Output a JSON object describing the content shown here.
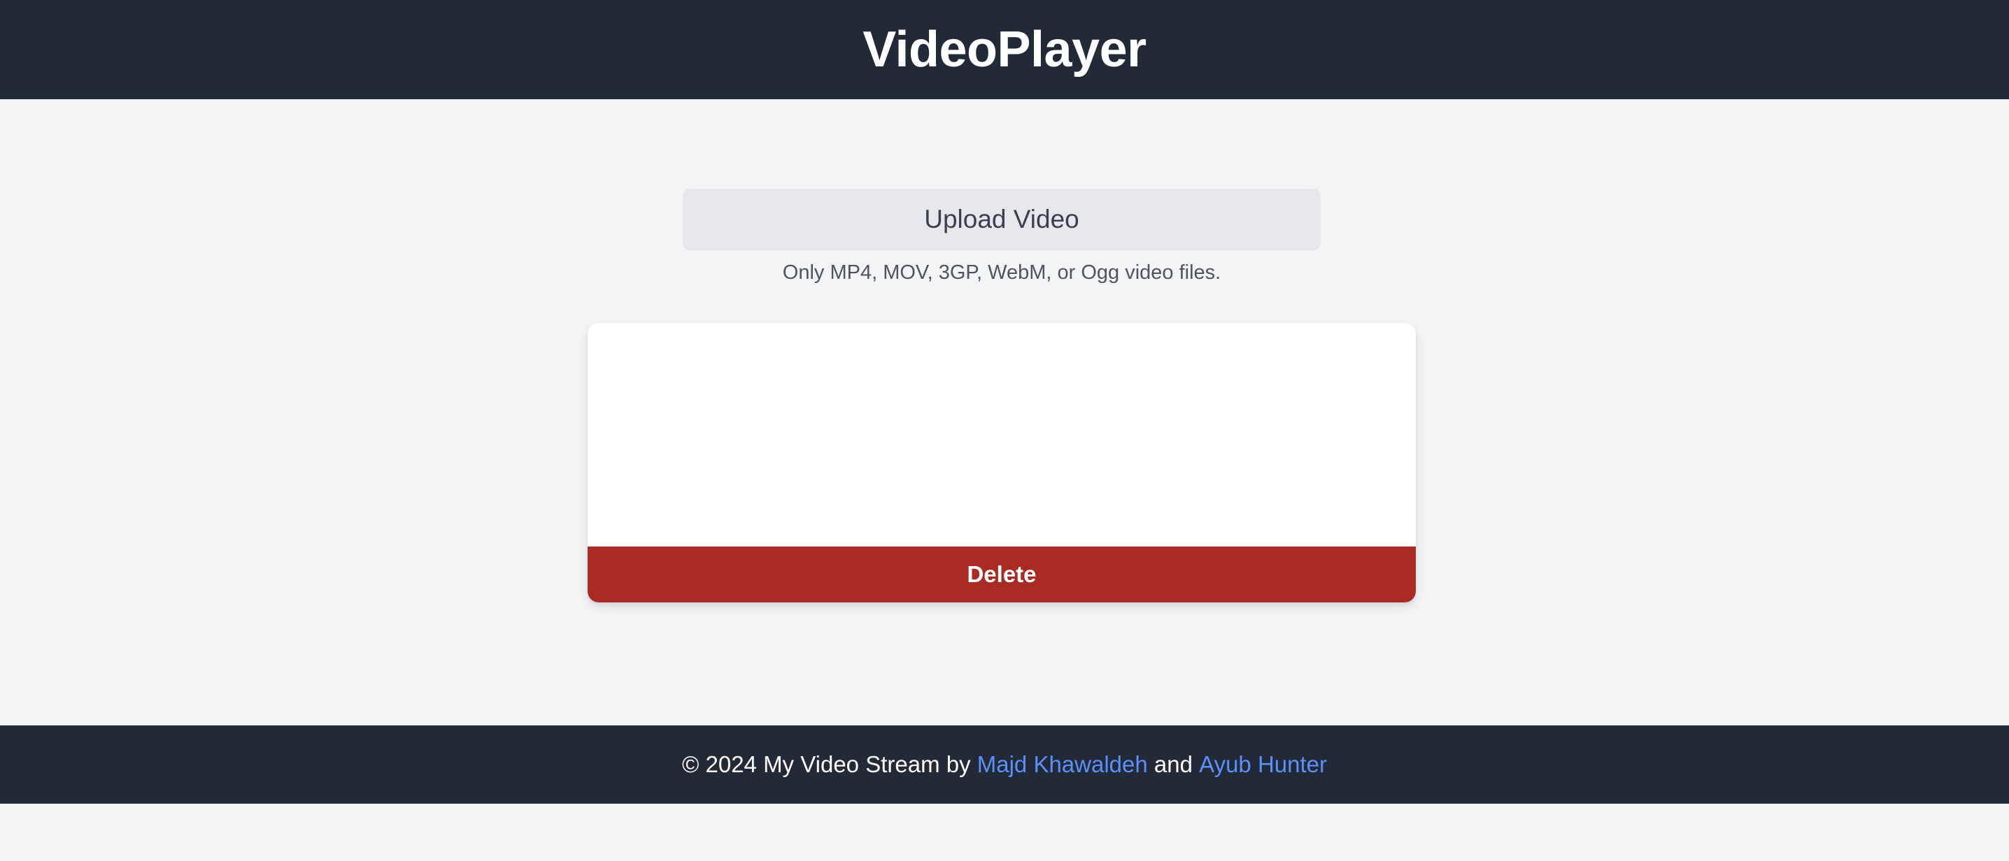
{
  "header": {
    "title": "VideoPlayer"
  },
  "upload": {
    "button_label": "Upload Video",
    "hint": "Only MP4, MOV, 3GP, WebM, or Ogg video files."
  },
  "video_card": {
    "delete_label": "Delete"
  },
  "footer": {
    "prefix": "© 2024 My Video Stream by ",
    "author1": "Majd Khawaldeh",
    "conjunction": " and ",
    "author2": "Ayub Hunter"
  },
  "colors": {
    "header_bg": "#222937",
    "page_bg": "#f3f4f6",
    "upload_button_bg": "#e5e7eb",
    "delete_button_bg": "#a92b25",
    "link": "#5b8ff9"
  }
}
